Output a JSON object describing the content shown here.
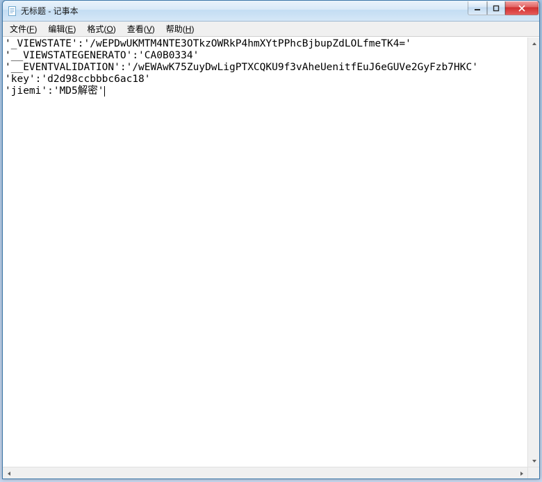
{
  "window": {
    "title": "无标题 - 记事本"
  },
  "menu": {
    "file": {
      "label": "文件",
      "accel": "F"
    },
    "edit": {
      "label": "编辑",
      "accel": "E"
    },
    "format": {
      "label": "格式",
      "accel": "O"
    },
    "view": {
      "label": "查看",
      "accel": "V"
    },
    "help": {
      "label": "帮助",
      "accel": "H"
    }
  },
  "content": {
    "line1": "'_VIEWSTATE':'/wEPDwUKMTM4NTE3OTkzOWRkP4hmXYtPPhcBjbupZdLOLfmeTK4='",
    "line2": "'__VIEWSTATEGENERATO':'CA0B0334'",
    "line3": "'__EVENTVALIDATION':'/wEWAwK75ZuyDwLigPTXCQKU9f3vAheUenitfEuJ6eGUVe2GyFzb7HKC'",
    "line4": "'key':'d2d98ccbbbc6ac18'",
    "line5": "'jiemi':'MD5解密'"
  }
}
